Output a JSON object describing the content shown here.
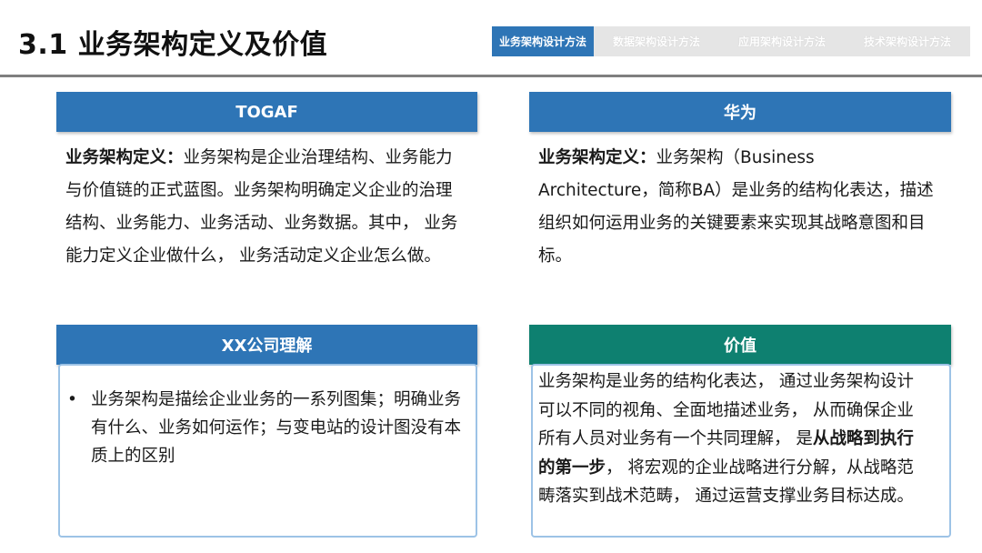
{
  "header": {
    "title": "3.1 业务架构定义及价值",
    "tabs": [
      {
        "label": "业务架构设计方法",
        "active": true
      },
      {
        "label": "数据架构设计方法",
        "active": false
      },
      {
        "label": "应用架构设计方法",
        "active": false
      },
      {
        "label": "技术架构设计方法",
        "active": false
      }
    ]
  },
  "togaf": {
    "heading": "TOGAF",
    "term": "业务架构定义",
    "colon": "：",
    "body": "业务架构是企业治理结构、业务能力与价值链的正式蓝图。业务架构明确定义企业的治理结构、业务能力、业务活动、业务数据。其中， 业务能力定义企业做什么， 业务活动定义企业怎么做。"
  },
  "huawei": {
    "heading": "华为",
    "term": "业务架构定义",
    "colon": "：",
    "body": "业务架构（Business Architecture，简称BA）是业务的结构化表达，描述组织如何运用业务的关键要素来实现其战略意图和目标。"
  },
  "company": {
    "heading": "XX公司理解",
    "bullet": "•",
    "body": "业务架构是描绘企业业务的一系列图集；明确业务有什么、业务如何运作；与变电站的设计图没有本质上的区别"
  },
  "value": {
    "heading": "价值",
    "body_before": "业务架构是业务的结构化表达， 通过业务架构设计可以不同的视角、全面地描述业务， 从而确保企业所有人员对业务有一个共同理解， 是",
    "body_bold": "从战略到执行的第一步",
    "body_after": "， 将宏观的企业战略进行分解，从战略范畴落实到战术范畴， 通过运营支撑业务目标达成。"
  },
  "colors": {
    "blue": "#2e75b6",
    "teal": "#0e8070",
    "box_border": "#9dc3e6",
    "rule": "#7f7f7f"
  }
}
